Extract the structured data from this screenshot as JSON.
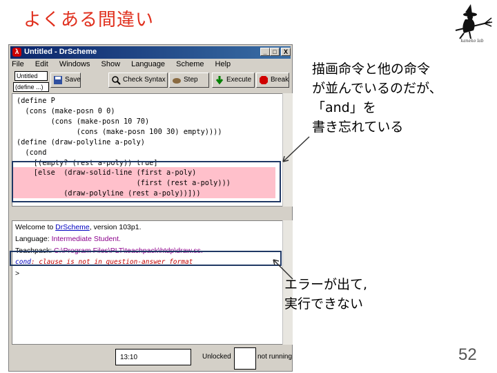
{
  "slide": {
    "title": "よくある間違い",
    "page_number": "52",
    "logo_caption": "kaneko lab"
  },
  "window": {
    "title": "Untitled - DrScheme",
    "controls": {
      "minimize": "_",
      "maximize": "□",
      "close": "X"
    },
    "menus": [
      "File",
      "Edit",
      "Windows",
      "Show",
      "Language",
      "Scheme",
      "Help"
    ],
    "name_field": "Untitled",
    "define_menu": "(define ...)",
    "toolbar": {
      "save": "Save",
      "check_syntax": "Check Syntax",
      "step": "Step",
      "execute": "Execute",
      "break": "Break"
    }
  },
  "editor": {
    "lines": [
      "(define P",
      "  (cons (make-posn 0 0)",
      "        (cons (make-posn 10 70)",
      "              (cons (make-posn 100 30) empty))))",
      "(define (draw-polyline a-poly)",
      "  (cond",
      "    [(empty? (rest a-poly)) true]",
      "    [else  (draw-solid-line (first a-poly)",
      "                            (first (rest a-poly)))",
      "           (draw-polyline (rest a-poly))]))"
    ]
  },
  "repl": {
    "welcome_prefix": "Welcome to ",
    "welcome_link": "DrScheme",
    "welcome_suffix": ", version 103p1.",
    "language_prefix": "Language: ",
    "language_value": "Intermediate Student.",
    "teachpack_prefix": "Teachpack: ",
    "teachpack_value": "C:\\Program Files\\PLT\\teachpack\\htdp\\draw.ss.",
    "error_keyword": "cond",
    "error_message": ": clause is not in question-answer format",
    "prompt": ">"
  },
  "statusbar": {
    "position": "13:10",
    "lock_state": "Unlocked",
    "run_state": "not running"
  },
  "annotations": {
    "top": [
      "描画命令と他の命令",
      "が並んでいるのだが、",
      "「and」を",
      "書き忘れている"
    ],
    "bottom": [
      "エラーが出て,",
      "実行できない"
    ]
  },
  "colors": {
    "title": "#e0301e",
    "highlight_fill": "#ffc0cb",
    "box_stroke": "#1f3864",
    "error_text": "#c00000"
  }
}
